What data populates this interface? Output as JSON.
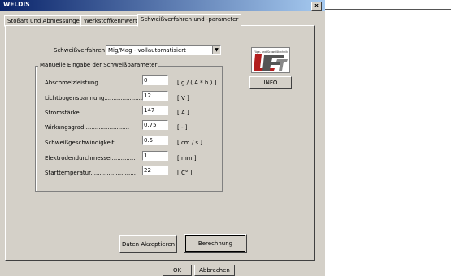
{
  "window": {
    "title": "WELDIS",
    "close_label": "x"
  },
  "tabs": [
    {
      "label": "Stoßart und Abmessungen"
    },
    {
      "label": "Werkstoffkennwerte"
    },
    {
      "label": "Schweißverfahren und -parameter"
    }
  ],
  "process": {
    "label": "Schweißverfahren wählen:",
    "selected": "Mig/Mag - vollautomatisiert"
  },
  "manual_group": {
    "title": "Manuelle Eingabe der Schweißparameter",
    "rows": [
      {
        "label": "Abschmelzleistung.........................",
        "value": "0",
        "unit": "[ g / ( A * h ) ]"
      },
      {
        "label": "Lichtbogenspannung.........................",
        "value": "12",
        "unit": "[ V ]"
      },
      {
        "label": "Stromstärke.........................",
        "value": "147",
        "unit": "[ A ]"
      },
      {
        "label": "Wirkungsgrad.........................",
        "value": "0.75",
        "unit": "[ - ]"
      },
      {
        "label": "Schweißgeschwindigkeit...........",
        "value": "0.5",
        "unit": "[ cm / s ]"
      },
      {
        "label": "Elektrodendurchmesser.............",
        "value": "1",
        "unit": "[ mm ]"
      },
      {
        "label": "Starttemperatur.........................",
        "value": "22",
        "unit": "[ C° ]"
      }
    ]
  },
  "logo": {
    "caption": "Füge- und Schweißtechnik",
    "text": "LFT"
  },
  "buttons": {
    "info": "INFO",
    "accept": "Daten Akzeptieren",
    "calculate": "Berechnung",
    "ok": "OK",
    "cancel": "Abbrechen"
  }
}
